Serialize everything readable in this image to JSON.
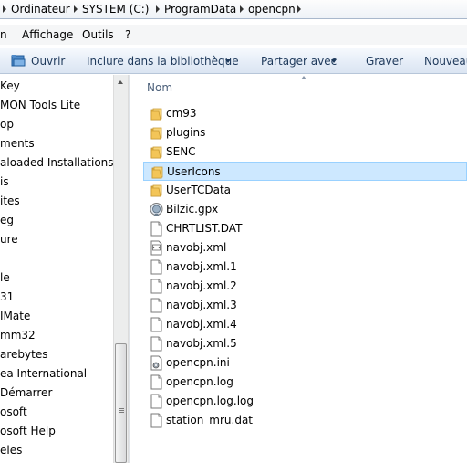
{
  "breadcrumb": [
    {
      "label": "Ordinateur"
    },
    {
      "label": "SYSTEM (C:)"
    },
    {
      "label": "ProgramData"
    },
    {
      "label": "opencpn"
    }
  ],
  "menu": [
    {
      "label": "n"
    },
    {
      "label": "Affichage"
    },
    {
      "label": "Outils"
    },
    {
      "label": "?"
    }
  ],
  "toolbar": {
    "organize_label": "Ouvrir",
    "include_label": "Inclure dans la bibliothèque",
    "share_label": "Partager avec",
    "burn_label": "Graver",
    "new_label": "Nouveau"
  },
  "nav": {
    "items": [
      {
        "label": "Key"
      },
      {
        "label": "MON Tools Lite"
      },
      {
        "label": "op"
      },
      {
        "label": "ments"
      },
      {
        "label": "aloaded Installations"
      },
      {
        "label": "is"
      },
      {
        "label": "ites"
      },
      {
        "label": "eg"
      },
      {
        "label": "ure"
      },
      {
        "label": ""
      },
      {
        "label": "le"
      },
      {
        "label": "31"
      },
      {
        "label": "IMate"
      },
      {
        "label": "mm32"
      },
      {
        "label": "arebytes"
      },
      {
        "label": "ea International"
      },
      {
        "label": "Démarrer"
      },
      {
        "label": "osoft"
      },
      {
        "label": "osoft Help"
      },
      {
        "label": "eles"
      }
    ]
  },
  "file_list": {
    "column_name": "Nom",
    "items": [
      {
        "name": "cm93",
        "icon": "folder-icon"
      },
      {
        "name": "plugins",
        "icon": "folder-icon"
      },
      {
        "name": "SENC",
        "icon": "folder-icon"
      },
      {
        "name": "UserIcons",
        "icon": "folder-icon",
        "selected": true
      },
      {
        "name": "UserTCData",
        "icon": "folder-icon"
      },
      {
        "name": "Bilzic.gpx",
        "icon": "gpx-file-icon"
      },
      {
        "name": "CHRTLIST.DAT",
        "icon": "file-icon"
      },
      {
        "name": "navobj.xml",
        "icon": "xml-file-icon"
      },
      {
        "name": "navobj.xml.1",
        "icon": "file-icon"
      },
      {
        "name": "navobj.xml.2",
        "icon": "file-icon"
      },
      {
        "name": "navobj.xml.3",
        "icon": "file-icon"
      },
      {
        "name": "navobj.xml.4",
        "icon": "file-icon"
      },
      {
        "name": "navobj.xml.5",
        "icon": "file-icon"
      },
      {
        "name": "opencpn.ini",
        "icon": "ini-file-icon"
      },
      {
        "name": "opencpn.log",
        "icon": "file-icon"
      },
      {
        "name": "opencpn.log.log",
        "icon": "file-icon"
      },
      {
        "name": "station_mru.dat",
        "icon": "file-icon"
      }
    ]
  }
}
